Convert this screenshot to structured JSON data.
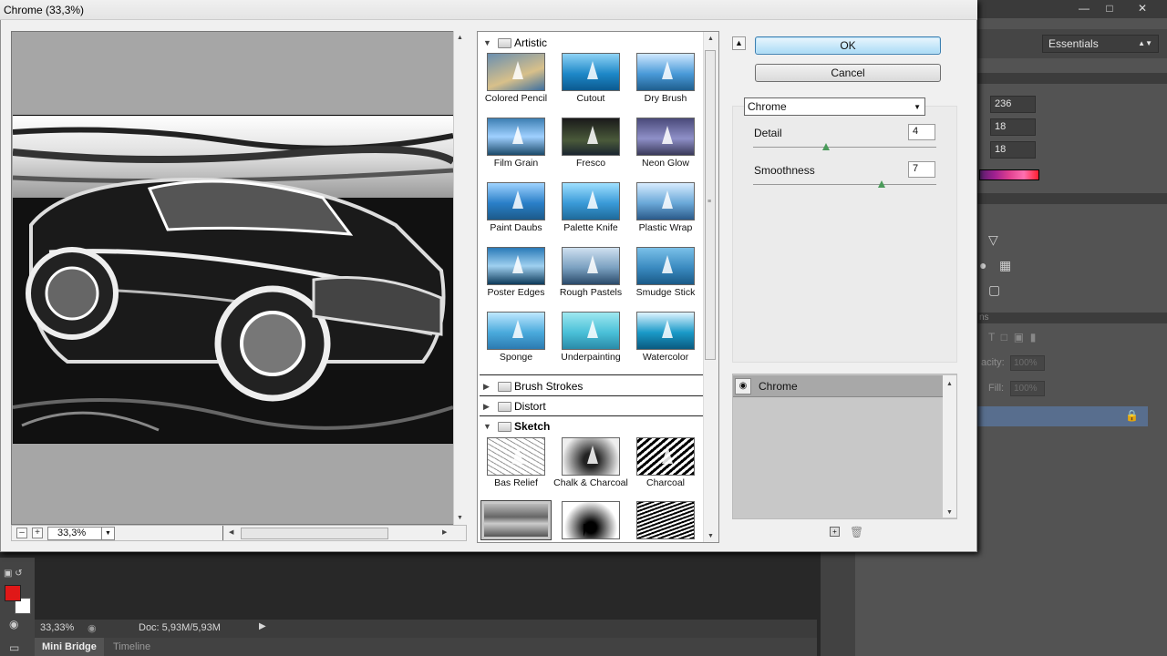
{
  "dialog": {
    "title": "Chrome (33,3%)",
    "ok_label": "OK",
    "cancel_label": "Cancel"
  },
  "preview": {
    "zoom": "33,3%"
  },
  "gallery": {
    "categories": [
      {
        "name": "Artistic",
        "expanded": true
      },
      {
        "name": "Brush Strokes",
        "expanded": false
      },
      {
        "name": "Distort",
        "expanded": false
      },
      {
        "name": "Sketch",
        "expanded": true
      }
    ],
    "artistic_filters": [
      "Colored Pencil",
      "Cutout",
      "Dry Brush",
      "Film Grain",
      "Fresco",
      "Neon Glow",
      "Paint Daubs",
      "Palette Knife",
      "Plastic Wrap",
      "Poster Edges",
      "Rough Pastels",
      "Smudge Stick",
      "Sponge",
      "Underpainting",
      "Watercolor"
    ],
    "sketch_filters": [
      "Bas Relief",
      "Chalk & Charcoal",
      "Charcoal"
    ]
  },
  "settings": {
    "filter": "Chrome",
    "detail": {
      "label": "Detail",
      "value": "4",
      "level": 0.4
    },
    "smoothness": {
      "label": "Smoothness",
      "value": "7",
      "level": 0.7
    }
  },
  "effect_layers": [
    {
      "name": "Chrome"
    }
  ],
  "ps": {
    "workspace": "Essentials",
    "color_values": [
      "236",
      "18",
      "18"
    ],
    "opacity_label": "acity:",
    "opacity_value": "100%",
    "fill_label": "Fill:",
    "fill_value": "100%",
    "panel_tab_fragment": "ns"
  },
  "status": {
    "zoom": "33,33%",
    "doc": "Doc: 5,93M/5,93M"
  },
  "bottom_tabs": [
    "Mini Bridge",
    "Timeline"
  ],
  "colors": {
    "foreground": "#e01818",
    "background": "#ffffff",
    "accent": "#3c7fb1"
  }
}
